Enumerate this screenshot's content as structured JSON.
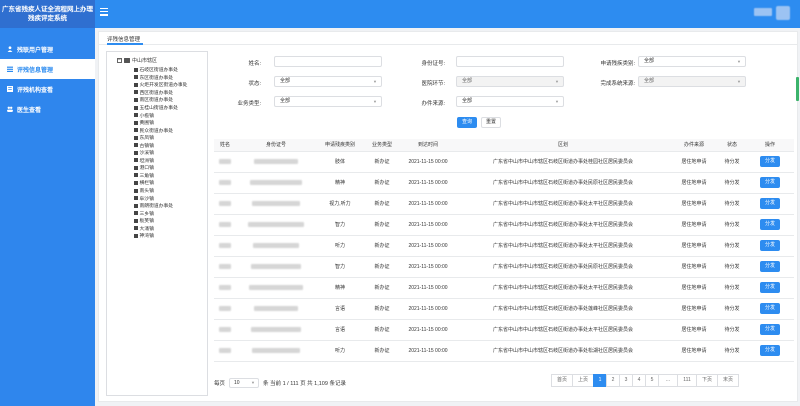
{
  "app": {
    "title_line1": "广东省残疾人证全流程网上办理",
    "title_line2": "残疾评定系统",
    "menu_icon": "hamburger-icon"
  },
  "sidebar": {
    "items": [
      {
        "label": "残联用户管理",
        "icon": "user-icon",
        "active": false
      },
      {
        "label": "评残信息管理",
        "icon": "list-icon",
        "active": true
      },
      {
        "label": "评残机构查看",
        "icon": "grid-icon",
        "active": false
      },
      {
        "label": "医生查看",
        "icon": "people-icon",
        "active": false
      }
    ]
  },
  "tab": {
    "label": "评残信息管理"
  },
  "tree": {
    "root": "中山市辖区",
    "children": [
      "石岐区街道办事处",
      "东区街道办事处",
      "火炬开发区街道办事处",
      "西区街道办事处",
      "南区街道办事处",
      "五桂山街道办事处",
      "小榄镇",
      "黄圃镇",
      "民众街道办事处",
      "东凤镇",
      "古镇镇",
      "沙溪镇",
      "坦洲镇",
      "港口镇",
      "三角镇",
      "横栏镇",
      "南头镇",
      "阜沙镇",
      "南朗街道办事处",
      "三乡镇",
      "板芙镇",
      "大涌镇",
      "神湾镇"
    ]
  },
  "filters": {
    "name_label": "姓名:",
    "id_label": "身份证号:",
    "apply_type_label": "申请残疾类别:",
    "apply_type_value": "全部",
    "status_label": "状态:",
    "status_value": "全部",
    "hospital_label": "医院环节:",
    "hospital_value": "全部",
    "finish_label": "完成系统来源:",
    "finish_value": "全部",
    "business_label": "业务类型:",
    "business_value": "全部",
    "source_label": "办件来源:",
    "source_value": "全部",
    "query_button": "查询",
    "reset_button": "重置"
  },
  "table": {
    "headers": [
      "姓名",
      "身份证号",
      "申请残疾类别",
      "业务类型",
      "到达时间",
      "区划",
      "办件来源",
      "状态",
      "操作"
    ],
    "rows": [
      {
        "type": "肢体",
        "biz": "新办证",
        "time": "2021-11-15 00:00",
        "area": "广东省中山市中山市辖区石岐区街道办事处桂园社区居民委员会",
        "source": "居住地申请",
        "status": "待分发",
        "action": "分发"
      },
      {
        "type": "精神",
        "biz": "新办证",
        "time": "2021-11-15 00:00",
        "area": "广东省中山市中山市辖区石岐区街道办事处民原社区居民委员会",
        "source": "居住地申请",
        "status": "待分发",
        "action": "分发"
      },
      {
        "type": "视力,听力",
        "biz": "新办证",
        "time": "2021-11-15 00:00",
        "area": "广东省中山市中山市辖区石岐区街道办事处太平社区居民委员会",
        "source": "居住地申请",
        "status": "待分发",
        "action": "分发"
      },
      {
        "type": "智力",
        "biz": "新办证",
        "time": "2021-11-15 00:00",
        "area": "广东省中山市中山市辖区石岐区街道办事处太平社区居民委员会",
        "source": "居住地申请",
        "status": "待分发",
        "action": "分发"
      },
      {
        "type": "听力",
        "biz": "新办证",
        "time": "2021-11-15 00:00",
        "area": "广东省中山市中山市辖区石岐区街道办事处太平社区居民委员会",
        "source": "居住地申请",
        "status": "待分发",
        "action": "分发"
      },
      {
        "type": "智力",
        "biz": "新办证",
        "time": "2021-11-15 00:00",
        "area": "广东省中山市中山市辖区石岐区街道办事处民原社区居民委员会",
        "source": "居住地申请",
        "status": "待分发",
        "action": "分发"
      },
      {
        "type": "精神",
        "biz": "新办证",
        "time": "2021-11-15 00:00",
        "area": "广东省中山市中山市辖区石岐区街道办事处太平社区居民委员会",
        "source": "居住地申请",
        "status": "待分发",
        "action": "分发"
      },
      {
        "type": "言语",
        "biz": "新办证",
        "time": "2021-11-15 00:00",
        "area": "广东省中山市中山市辖区石岐区街道办事处莲峰社区居民委员会",
        "source": "居住地申请",
        "status": "待分发",
        "action": "分发"
      },
      {
        "type": "言语",
        "biz": "新办证",
        "time": "2021-11-15 00:00",
        "area": "广东省中山市中山市辖区石岐区街道办事处太平社区居民委员会",
        "source": "居住地申请",
        "status": "待分发",
        "action": "分发"
      },
      {
        "type": "听力",
        "biz": "新办证",
        "time": "2021-11-15 00:00",
        "area": "广东省中山市中山市辖区石岐区街道办事处松湖社区居民委员会",
        "source": "居住地申请",
        "status": "待分发",
        "action": "分发"
      }
    ]
  },
  "pagination": {
    "per_page_label": "每页",
    "page_size": "10",
    "summary": "条 当前 1 / 111 页 共 1,109 条记录",
    "buttons": [
      "首页",
      "上页",
      "1",
      "2",
      "3",
      "4",
      "5",
      "...",
      "111",
      "下页",
      "末页"
    ],
    "active": "1"
  },
  "colors": {
    "primary": "#2d8cf0",
    "sidebar": "#2f86ed",
    "logo_bg": "#2f6fd0"
  }
}
